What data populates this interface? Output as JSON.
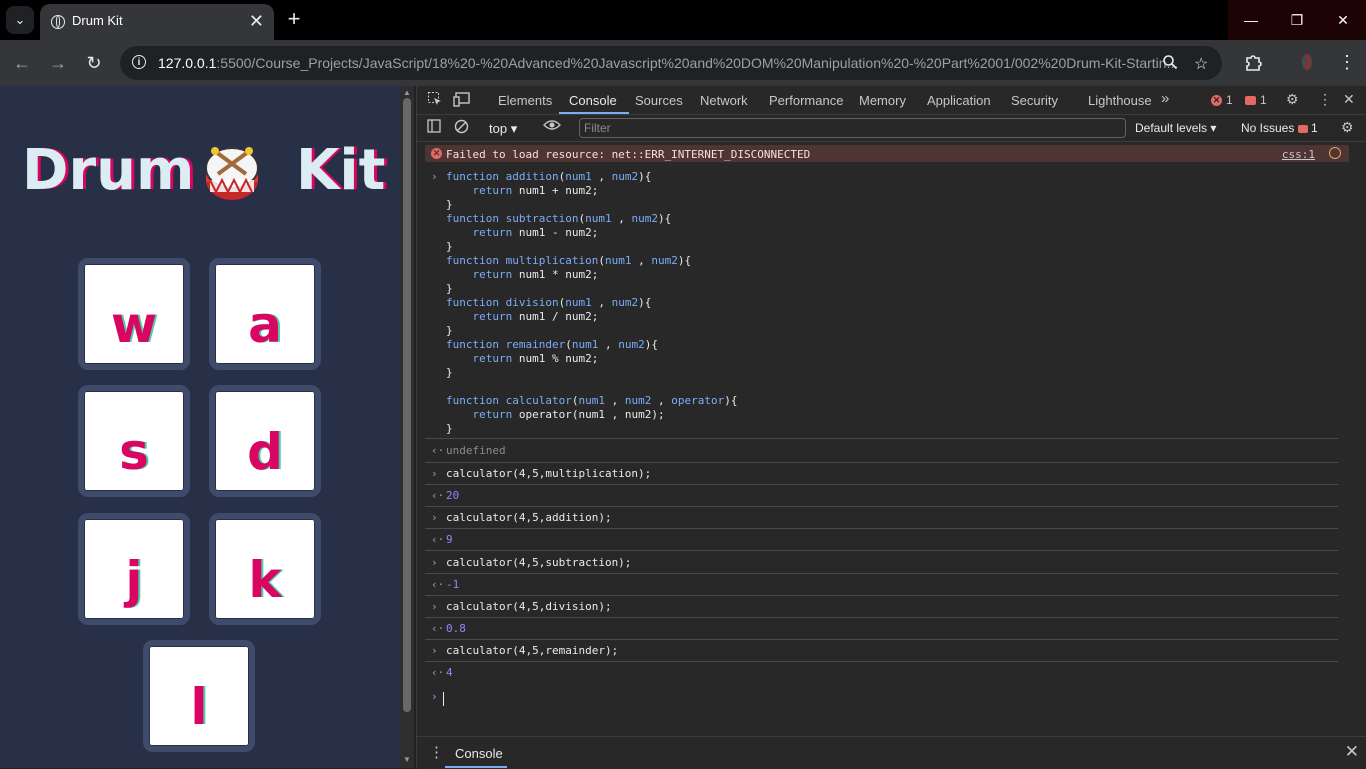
{
  "browser": {
    "tab_title": "Drum Kit",
    "tab_close": "✕",
    "new_tab": "+",
    "url_host": "127.0.0.1",
    "url_rest": ":5500/Course_Projects/JavaScript/18%20-%20Advanced%20Javascript%20and%20DOM%20Manipulation%20-%20Part%2001/002%20Drum-Kit-Startin...",
    "window": {
      "minimize": "—",
      "maximize": "❐",
      "close": "✕"
    }
  },
  "page": {
    "title_left": "Drum",
    "title_right": "Kit",
    "keys": [
      "w",
      "a",
      "s",
      "d",
      "j",
      "k",
      "l"
    ],
    "colors": {
      "background": "#283048",
      "accent": "#da0463",
      "key_border": "#404b69"
    }
  },
  "devtools": {
    "tabs": [
      "Elements",
      "Console",
      "Sources",
      "Network",
      "Performance",
      "Memory",
      "Application",
      "Security",
      "Lighthouse"
    ],
    "more_tabs": "»",
    "error_count": "1",
    "issue_count": "1",
    "context": "top",
    "filter_placeholder": "Filter",
    "levels": "Default levels",
    "no_issues": "No Issues",
    "no_issues_count": "1",
    "error_message": "Failed to load resource: net::ERR_INTERNET_DISCONNECTED",
    "error_source": "css:1",
    "result_undefined": "undefined",
    "commands": [
      {
        "input": "calculator(4,5,multiplication);",
        "output": "20"
      },
      {
        "input": "calculator(4,5,addition);",
        "output": "9"
      },
      {
        "input": "calculator(4,5,subtraction);",
        "output": "-1"
      },
      {
        "input": "calculator(4,5,division);",
        "output": "0.8"
      },
      {
        "input": "calculator(4,5,remainder);",
        "output": "4"
      }
    ],
    "drawer_tab": "Console"
  }
}
